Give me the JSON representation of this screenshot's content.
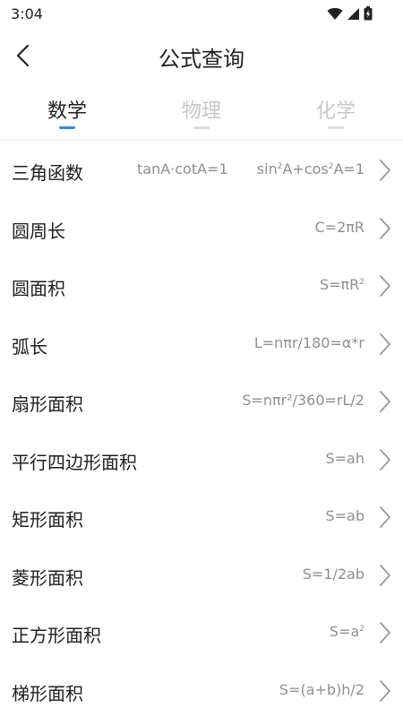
{
  "status": {
    "time": "3:04"
  },
  "header": {
    "title": "公式查询"
  },
  "tabs": [
    {
      "label": "数学",
      "active": true
    },
    {
      "label": "物理",
      "active": false
    },
    {
      "label": "化学",
      "active": false
    }
  ],
  "formulas": [
    {
      "name": "三角函数",
      "formula_extra": "tanA·cotA=1",
      "formula_pre": "sin",
      "formula_sup1": "2",
      "formula_mid": "A+cos",
      "formula_sup2": "2",
      "formula_post": "A=1"
    },
    {
      "name": "圆周长",
      "formula": "C=2πR"
    },
    {
      "name": "圆面积",
      "formula_pre": "S=πR",
      "formula_sup": "2"
    },
    {
      "name": "弧长",
      "formula": "L=nπr/180=α*r"
    },
    {
      "name": "扇形面积",
      "formula": "S=nπr²/360=rL/2"
    },
    {
      "name": "平行四边形面积",
      "formula": "S=ah"
    },
    {
      "name": "矩形面积",
      "formula": "S=ab"
    },
    {
      "name": "菱形面积",
      "formula": "S=1/2ab"
    },
    {
      "name": "正方形面积",
      "formula_pre": "S=a",
      "formula_sup": "2"
    },
    {
      "name": "梯形面积",
      "formula": "S=(a+b)h/2"
    }
  ],
  "colors": {
    "accent": "#2e8bf0",
    "text": "#222222",
    "secondary": "#8f8f8f",
    "inactive_tab": "#c8c8c8"
  }
}
